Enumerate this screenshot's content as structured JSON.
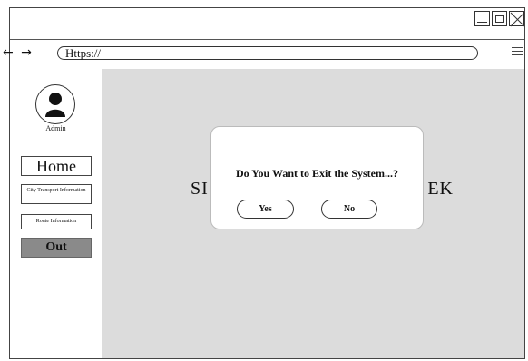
{
  "browser": {
    "nav_arrows": "← →",
    "url": "Https://"
  },
  "sidebar": {
    "user_label": "Admin",
    "items": [
      {
        "label": "Home"
      },
      {
        "label": "City Transport Information"
      },
      {
        "label": "Route Information"
      },
      {
        "label": "Out"
      }
    ]
  },
  "main": {
    "title_left": "SI",
    "title_right": "EK"
  },
  "dialog": {
    "message": "Do You Want to Exit the System...?",
    "yes_label": "Yes",
    "no_label": "No"
  },
  "colors": {
    "content_background": "#dcdcdc",
    "out_button": "#8a8a8a"
  },
  "icons": [
    "minimize-icon",
    "maximize-icon",
    "close-icon",
    "menu-icon",
    "user-icon"
  ]
}
